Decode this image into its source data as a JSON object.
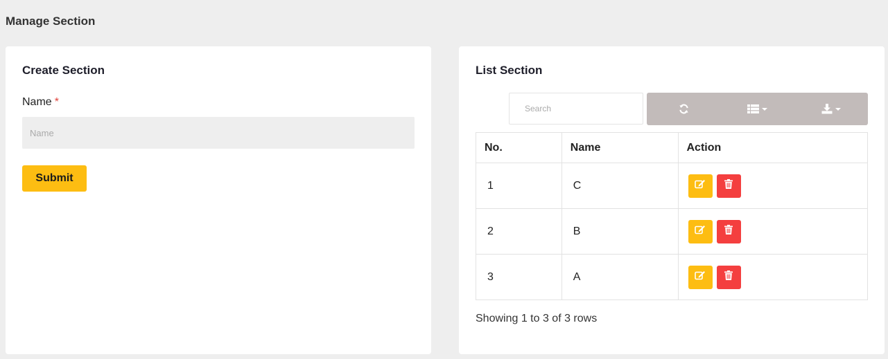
{
  "page": {
    "title": "Manage Section"
  },
  "create": {
    "title": "Create Section",
    "name_label": "Name",
    "required_mark": "*",
    "name_placeholder": "Name",
    "submit_label": "Submit"
  },
  "list": {
    "title": "List Section",
    "search_placeholder": "Search",
    "toolbar_icons": [
      "refresh-icon",
      "columns-icon",
      "export-icon"
    ],
    "columns": [
      "No.",
      "Name",
      "Action"
    ],
    "rows": [
      {
        "no": "1",
        "name": "C"
      },
      {
        "no": "2",
        "name": "B"
      },
      {
        "no": "3",
        "name": "A"
      }
    ],
    "footer": "Showing 1 to 3 of 3 rows"
  },
  "colors": {
    "accent": "#fdbd12",
    "danger": "#f43f3f",
    "toolbar": "#c2bbba",
    "background": "#eeeeee"
  }
}
